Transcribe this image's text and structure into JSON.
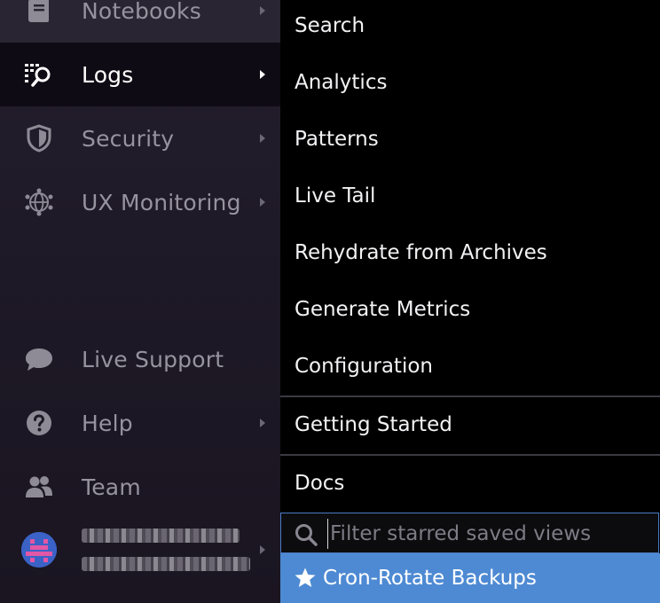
{
  "sidebar": {
    "items": [
      {
        "label": "Notebooks",
        "icon": "notebook-icon",
        "has_submenu": true
      },
      {
        "label": "Logs",
        "icon": "logs-icon",
        "has_submenu": true,
        "active": true
      },
      {
        "label": "Security",
        "icon": "shield-icon",
        "has_submenu": true
      },
      {
        "label": "UX Monitoring",
        "icon": "globe-network-icon",
        "has_submenu": true
      },
      {
        "label": "Live Support",
        "icon": "chat-bubble-icon",
        "has_submenu": false
      },
      {
        "label": "Help",
        "icon": "help-circle-icon",
        "has_submenu": true
      },
      {
        "label": "Team",
        "icon": "team-icon",
        "has_submenu": false
      }
    ],
    "user": {
      "icon": "user-avatar-icon"
    }
  },
  "submenu": {
    "items": [
      {
        "label": "Search"
      },
      {
        "label": "Analytics"
      },
      {
        "label": "Patterns"
      },
      {
        "label": "Live Tail"
      },
      {
        "label": "Rehydrate from Archives"
      },
      {
        "label": "Generate Metrics"
      },
      {
        "label": "Configuration"
      }
    ],
    "getting_started": "Getting Started",
    "docs": "Docs",
    "filter": {
      "placeholder": "Filter starred saved views",
      "value": ""
    },
    "starred_views": [
      {
        "label": "Cron-Rotate Backups"
      }
    ]
  },
  "colors": {
    "sidebar_bg": "#1e1926",
    "active_bg": "#0f0b14",
    "submenu_bg": "#000000",
    "highlight": "#4e8ad3",
    "focus_border": "#4b7bc4"
  }
}
